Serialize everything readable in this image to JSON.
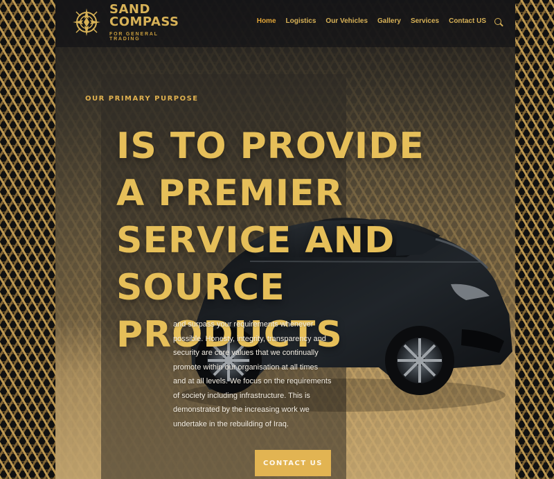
{
  "brand": {
    "title": "SAND COMPASS",
    "subtitle": "FOR GENERAL TRADING",
    "logo_icon": "compass-icon"
  },
  "nav": {
    "items": [
      {
        "label": "Home",
        "active": true
      },
      {
        "label": "Logistics",
        "active": false
      },
      {
        "label": "Our Vehicles",
        "active": false
      },
      {
        "label": "Gallery",
        "active": false
      },
      {
        "label": "Services",
        "active": false
      },
      {
        "label": "Contact US",
        "active": false
      }
    ],
    "search_icon": "search-icon"
  },
  "hero": {
    "eyebrow": "OUR PRIMARY PURPOSE",
    "headline": "IS TO PROVIDE A PREMIER SERVICE AND SOURCE PRODUCTS",
    "body": "and surpass your requirements whenever possible. Honesty, integrity, transparency and security are core values that we continually promote within our organisation at all times and at all levels. We focus on the requirements of society including infrastructure. This is demonstrated by the increasing work we undertake in the rebuilding of Iraq.",
    "cta": "CONTACT US"
  },
  "colors": {
    "accent": "#e2b452",
    "accent_dark": "#c99d3d",
    "text_light": "#f4eee3",
    "header_bg": "#1f1b16"
  }
}
